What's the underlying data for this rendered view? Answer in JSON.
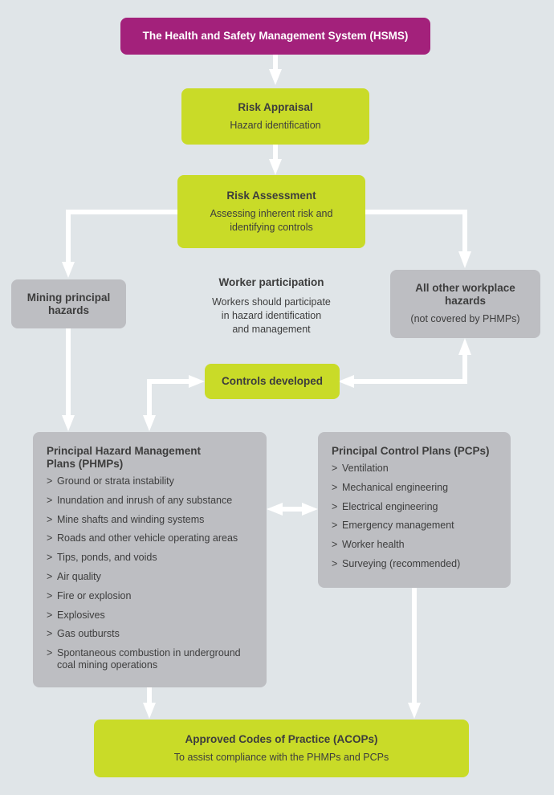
{
  "colors": {
    "background": "#e0e5e8",
    "hsms": "#a3217b",
    "lime": "#c9db28",
    "gray": "#bdbec2",
    "arrow": "#ffffff",
    "text": "#3d3d3d"
  },
  "hsms": {
    "title": "The Health and Safety Management System (HSMS)"
  },
  "risk_appraisal": {
    "title": "Risk Appraisal",
    "subtitle": "Hazard identification"
  },
  "risk_assessment": {
    "title": "Risk Assessment",
    "subtitle_line1": "Assessing inherent risk and",
    "subtitle_line2": "identifying controls"
  },
  "mining_hazards": {
    "title_line1": "Mining principal",
    "title_line2": "hazards"
  },
  "worker_participation": {
    "title": "Worker participation",
    "line1": "Workers should participate",
    "line2": "in hazard identification",
    "line3": "and management"
  },
  "other_hazards": {
    "title_line1": "All other workplace",
    "title_line2": "hazards",
    "subtitle": "(not covered by PHMPs)"
  },
  "controls_developed": {
    "title": "Controls developed"
  },
  "phmps": {
    "title_line1": "Principal Hazard Management",
    "title_line2": "Plans (PHMPs)",
    "bullet": ">",
    "items": [
      "Ground or strata instability",
      "Inundation and inrush of any substance",
      "Mine shafts and winding systems",
      "Roads and other vehicle operating areas",
      "Tips, ponds, and voids",
      "Air quality",
      "Fire or explosion",
      "Explosives",
      "Gas outbursts",
      "Spontaneous combustion in underground coal mining operations"
    ]
  },
  "pcps": {
    "title": "Principal Control Plans (PCPs)",
    "bullet": ">",
    "items": [
      "Ventilation",
      "Mechanical engineering",
      "Electrical engineering",
      "Emergency management",
      "Worker health",
      "Surveying (recommended)"
    ]
  },
  "acops": {
    "title": "Approved Codes of Practice (ACOPs)",
    "subtitle": "To assist compliance with the PHMPs and PCPs"
  }
}
